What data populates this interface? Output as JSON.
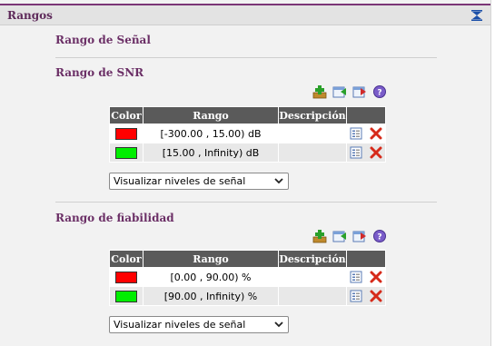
{
  "panel": {
    "title": "Rangos",
    "collapse_icon": "collapse-icon"
  },
  "sections": [
    {
      "title": "Rango de Señal"
    },
    {
      "title": "Rango de SNR",
      "toolbar": {
        "icons": [
          "add-icon",
          "import-icon",
          "export-icon",
          "help-icon"
        ]
      },
      "table": {
        "headers": [
          "Color",
          "Rango",
          "Descripción",
          ""
        ],
        "rows": [
          {
            "color": "#ff0000",
            "range": "[-300.00 , 15.00) dB",
            "description": ""
          },
          {
            "color": "#00ee00",
            "range": "[15.00 , Infinity) dB",
            "description": ""
          }
        ]
      },
      "select": {
        "value": "Visualizar niveles de señal"
      }
    },
    {
      "title": "Rango de fiabilidad",
      "toolbar": {
        "icons": [
          "add-icon",
          "import-icon",
          "export-icon",
          "help-icon"
        ]
      },
      "table": {
        "headers": [
          "Color",
          "Rango",
          "Descripción",
          ""
        ],
        "rows": [
          {
            "color": "#ff0000",
            "range": "[0.00 , 90.00) %",
            "description": ""
          },
          {
            "color": "#00ee00",
            "range": "[90.00 , Infinity) %",
            "description": ""
          }
        ]
      },
      "select": {
        "value": "Visualizar niveles de señal"
      }
    }
  ],
  "colors": {
    "accent": "#6b2f66",
    "header_bg": "#e3e3e3",
    "table_header": "#5a5a5a",
    "panel_bg": "#f2f2f2"
  }
}
